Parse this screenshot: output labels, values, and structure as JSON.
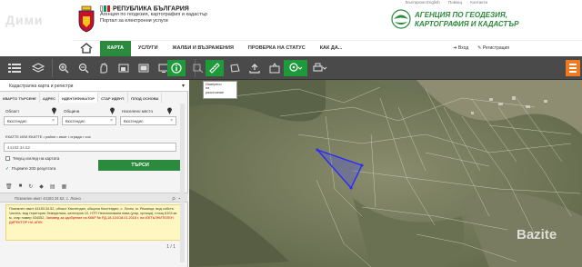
{
  "header": {
    "gov_title": "РЕПУБЛИКА БЪЛГАРИЯ",
    "gov_line2": "Агенция по геодезия, картография и кадастър",
    "gov_line3": "Портал за електронни услуги",
    "agency_name_line1": "АГЕНЦИЯ ПО ГЕОДЕЗИЯ,",
    "agency_name_line2": "КАРТОГРАФИЯ И КАДАСТЪР",
    "lang_english": "Български English",
    "lang_help": "Помощ",
    "lang_contacts": "Контакти",
    "watermark_left": "Дими",
    "watermark_right": "Bazite"
  },
  "nav": {
    "tabs": [
      "КАРТА",
      "УСЛУГИ",
      "ЖАЛБИ И ВЪЗРАЖЕНИЯ",
      "ПРОВЕРКА НА СТАТУС",
      "КАК ДА..."
    ],
    "active_tab": "КАРТА",
    "login": "Вход",
    "register": "Регистрация"
  },
  "panel": {
    "title": "Кадастрална карта и регистри",
    "subtabs": [
      "КВАРТО ТЪРСЕНЕ",
      "АДРЕС",
      "ИДЕНТИФИКАТОР",
      "СТАР ИДЕНТ.",
      "ПЛОД ОСНОВА"
    ],
    "active_subtab": "ИДЕНТИФИКАТОР",
    "oblast_label": "Област",
    "obshtina_label": "Община",
    "naseleno_label": "Населено място",
    "oblast_value": "Кюстендил",
    "obshtina_value": "Кюстендил",
    "naseleno_value": "Кюстендил",
    "identifier_label": "ЕКАТТЕ ИЛИ ЕКАТТЕ • район • имот • сграда • сос",
    "identifier_value": "44183.34.52",
    "check_current_map": "Текущ изглед на картата",
    "check_first_200": "Първите 200 резултата",
    "search_button": "ТЪРСИ",
    "result_header": "Поземлен имот 44183.34.52, с. Лозно",
    "result_text_1": "Поземлен имот 44183.34.52, област Кюстендил, община Кюстендил, с. Лозно, м.",
    "result_text_2": "Режанци, вид собств. Частна, вид територия Земеделска, категория 10, НТП",
    "result_text_3": "Неизползвана нива (угар, орница), площ 6103 кв. м, стар номер 034052,",
    "result_text_4": "Заповед за одобрение на КККР № РД-18-104/18.01.2018 г. на ИЗПЪЛНИТЕЛЕН",
    "result_text_5": "ДИРЕКТОР НА АГКК",
    "pager": "1 / 1",
    "popup_text_1": "Измерено",
    "popup_text_2": "на",
    "popup_text_3": "разстояние"
  },
  "colors": {
    "brand_green": "#2b8a3e",
    "toolbar_bg": "#4a4a4a",
    "selection_polygon": "#2a2aff",
    "orange_button": "#f07a1f"
  }
}
